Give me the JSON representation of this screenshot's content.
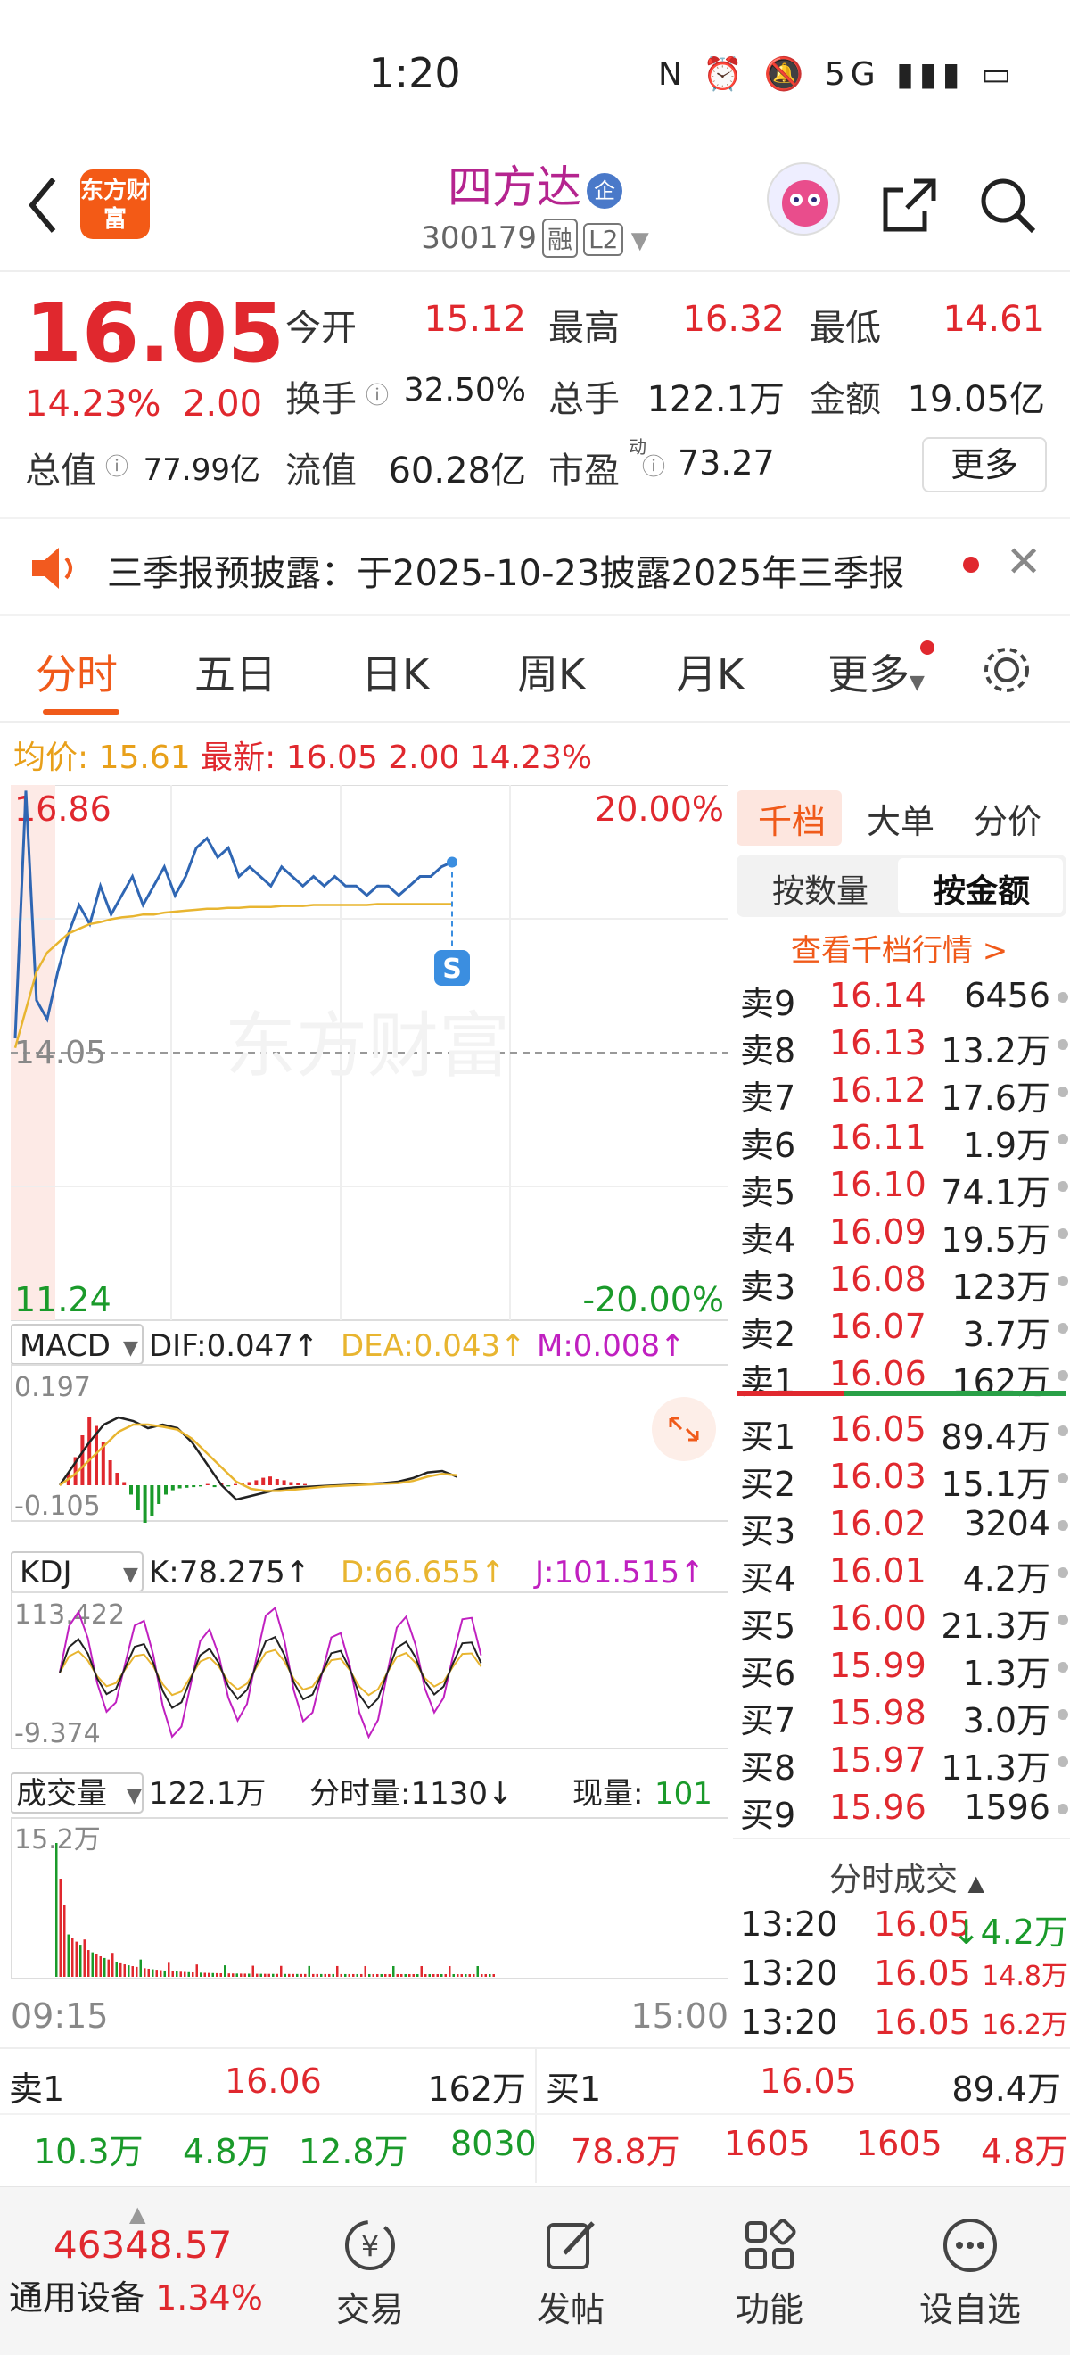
{
  "status_bar": {
    "time": "1:20",
    "icons_text": "N ⏰ 🔕 5G ▮▮▮ ▭"
  },
  "header": {
    "logo_text": "东方财富",
    "stock_name": "四方达",
    "name_badge": "企",
    "stock_code": "300179",
    "tags": [
      "融",
      "L2"
    ]
  },
  "quote": {
    "price": "16.05",
    "change_pct": "14.23%",
    "change": "2.00",
    "fields": [
      {
        "label": "今开",
        "value": "15.12",
        "color": "red"
      },
      {
        "label": "最高",
        "value": "16.32",
        "color": "red"
      },
      {
        "label": "最低",
        "value": "14.61",
        "color": "red"
      },
      {
        "label": "换手",
        "value": "32.50%",
        "color": "black"
      },
      {
        "label": "总手",
        "value": "122.1万",
        "color": "black"
      },
      {
        "label": "金额",
        "value": "19.05亿",
        "color": "black"
      },
      {
        "label": "总值",
        "value": "77.99亿",
        "color": "black"
      },
      {
        "label": "流值",
        "value": "60.28亿",
        "color": "black"
      },
      {
        "label": "市盈",
        "value": "73.27",
        "color": "black"
      }
    ],
    "pe_sup": "动",
    "more_label": "更多"
  },
  "notice": {
    "text": "三季报预披露：于2025-10-23披露2025年三季报"
  },
  "tabs": [
    "分时",
    "五日",
    "日K",
    "周K",
    "月K",
    "更多"
  ],
  "avg_line": {
    "avg_label": "均价:",
    "avg_value": "15.61",
    "latest_label": "最新:",
    "latest_value": "16.05",
    "change": "2.00",
    "pct": "14.23%"
  },
  "chart_data": [
    {
      "type": "line",
      "name": "intraday",
      "y_top": "16.86",
      "y_mid": "14.05",
      "y_bottom": "11.24",
      "pct_top": "20.00%",
      "pct_bottom": "-20.00%",
      "time_start": "09:15",
      "time_end": "15:00",
      "series": [
        {
          "name": "价格",
          "color": "#2f66b3",
          "values": [
            14.2,
            16.8,
            14.6,
            14.4,
            14.9,
            15.3,
            15.6,
            15.4,
            15.8,
            15.5,
            15.7,
            15.9,
            15.6,
            15.8,
            16.0,
            15.7,
            15.9,
            16.2,
            16.3,
            16.1,
            16.2,
            15.9,
            16.0,
            15.9,
            15.8,
            16.0,
            15.9,
            15.8,
            15.9,
            15.8,
            15.9,
            15.8,
            15.8,
            15.7,
            15.8,
            15.8,
            15.7,
            15.8,
            15.9,
            15.9,
            16.0,
            16.05
          ]
        },
        {
          "name": "均价",
          "color": "#e8b530",
          "values": [
            14.1,
            14.5,
            14.9,
            15.1,
            15.2,
            15.3,
            15.35,
            15.4,
            15.42,
            15.45,
            15.47,
            15.48,
            15.5,
            15.5,
            15.52,
            15.53,
            15.54,
            15.55,
            15.56,
            15.56,
            15.57,
            15.57,
            15.58,
            15.58,
            15.58,
            15.59,
            15.59,
            15.59,
            15.6,
            15.6,
            15.6,
            15.6,
            15.6,
            15.6,
            15.61,
            15.61,
            15.61,
            15.61,
            15.61,
            15.61,
            15.61,
            15.61
          ]
        }
      ]
    },
    {
      "type": "line",
      "name": "MACD",
      "label": "MACD",
      "dif": "DIF:0.047↑",
      "dea": "DEA:0.043↑",
      "m": "M:0.008↑",
      "y_top": "0.197",
      "y_bottom": "-0.105"
    },
    {
      "type": "line",
      "name": "KDJ",
      "label": "KDJ",
      "k": "K:78.275↑",
      "d": "D:66.655↑",
      "j": "J:101.515↑",
      "y_top": "113.422",
      "y_bottom": "-9.374"
    },
    {
      "type": "bar",
      "name": "成交量",
      "label": "成交量",
      "total": "122.1万",
      "tick_vol": "分时量:1130↓",
      "now_label": "现量:",
      "now_val": "101",
      "y_top": "15.2万"
    }
  ],
  "orderbook": {
    "tabs": [
      "千档",
      "大单",
      "分价"
    ],
    "subtabs": [
      "按数量",
      "按金额"
    ],
    "link": "查看千档行情 >",
    "sells": [
      {
        "label": "卖9",
        "price": "16.14",
        "vol": "6456"
      },
      {
        "label": "卖8",
        "price": "16.13",
        "vol": "13.2万"
      },
      {
        "label": "卖7",
        "price": "16.12",
        "vol": "17.6万"
      },
      {
        "label": "卖6",
        "price": "16.11",
        "vol": "1.9万"
      },
      {
        "label": "卖5",
        "price": "16.10",
        "vol": "74.1万"
      },
      {
        "label": "卖4",
        "price": "16.09",
        "vol": "19.5万"
      },
      {
        "label": "卖3",
        "price": "16.08",
        "vol": "123万"
      },
      {
        "label": "卖2",
        "price": "16.07",
        "vol": "3.7万"
      },
      {
        "label": "卖1",
        "price": "16.06",
        "vol": "162万"
      }
    ],
    "buys": [
      {
        "label": "买1",
        "price": "16.05",
        "vol": "89.4万"
      },
      {
        "label": "买2",
        "price": "16.03",
        "vol": "15.1万"
      },
      {
        "label": "买3",
        "price": "16.02",
        "vol": "3204"
      },
      {
        "label": "买4",
        "price": "16.01",
        "vol": "4.2万"
      },
      {
        "label": "买5",
        "price": "16.00",
        "vol": "21.3万"
      },
      {
        "label": "买6",
        "price": "15.99",
        "vol": "1.3万"
      },
      {
        "label": "买7",
        "price": "15.98",
        "vol": "3.0万"
      },
      {
        "label": "买8",
        "price": "15.97",
        "vol": "11.3万"
      },
      {
        "label": "买9",
        "price": "15.96",
        "vol": "1596"
      }
    ],
    "trades_title": "分时成交",
    "trades": [
      {
        "time": "13:20",
        "price": "16.05",
        "vol": "↓4.2万"
      },
      {
        "time": "13:20",
        "price": "16.05",
        "vol": "14.8万"
      },
      {
        "time": "13:20",
        "price": "16.05",
        "vol": "16.2万"
      }
    ]
  },
  "ticker": {
    "sell_label": "卖1",
    "sell_price": "16.06",
    "sell_vol": "162万",
    "buy_label": "买1",
    "buy_price": "16.05",
    "buy_vol": "89.4万",
    "sell_row": [
      "10.3万",
      "4.8万",
      "12.8万",
      "8030"
    ],
    "buy_row": [
      "78.8万",
      "1605",
      "1605",
      "4.8万"
    ]
  },
  "bottom_nav": {
    "index_value": "46348.57",
    "index_name": "通用设备",
    "index_pct": "1.34%",
    "items": [
      "交易",
      "发帖",
      "功能",
      "设自选"
    ]
  }
}
